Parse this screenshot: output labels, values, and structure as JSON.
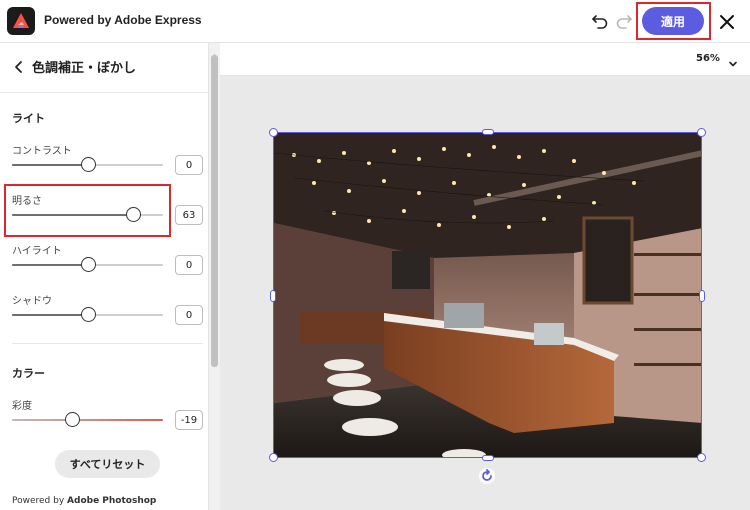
{
  "header": {
    "app_title": "Powered by Adobe Express",
    "apply_label": "適用"
  },
  "panel": {
    "title": "色調補正・ぼかし",
    "light_section": "ライト",
    "color_section": "カラー",
    "sliders": {
      "contrast": {
        "label": "コントラスト",
        "value": "0",
        "level": 0.5
      },
      "brightness": {
        "label": "明るさ",
        "value": "63",
        "level": 0.8
      },
      "highlights": {
        "label": "ハイライト",
        "value": "0",
        "level": 0.5
      },
      "shadows": {
        "label": "シャドウ",
        "value": "0",
        "level": 0.5
      },
      "saturation": {
        "label": "彩度",
        "value": "-19",
        "level": 0.4
      }
    },
    "reset_label": "すべてリセット",
    "powered_prefix": "Powered by ",
    "powered_brand": "Adobe Photoshop"
  },
  "canvas": {
    "zoom": "56%"
  },
  "colors": {
    "accent": "#5c5ce0",
    "highlight_box": "#e0262b",
    "saturation_track": "#e05a4e"
  },
  "icons": [
    "adobe-express-logo-icon",
    "undo-icon",
    "redo-icon",
    "close-icon",
    "chevron-left-icon",
    "chevron-down-icon",
    "rotate-icon"
  ]
}
